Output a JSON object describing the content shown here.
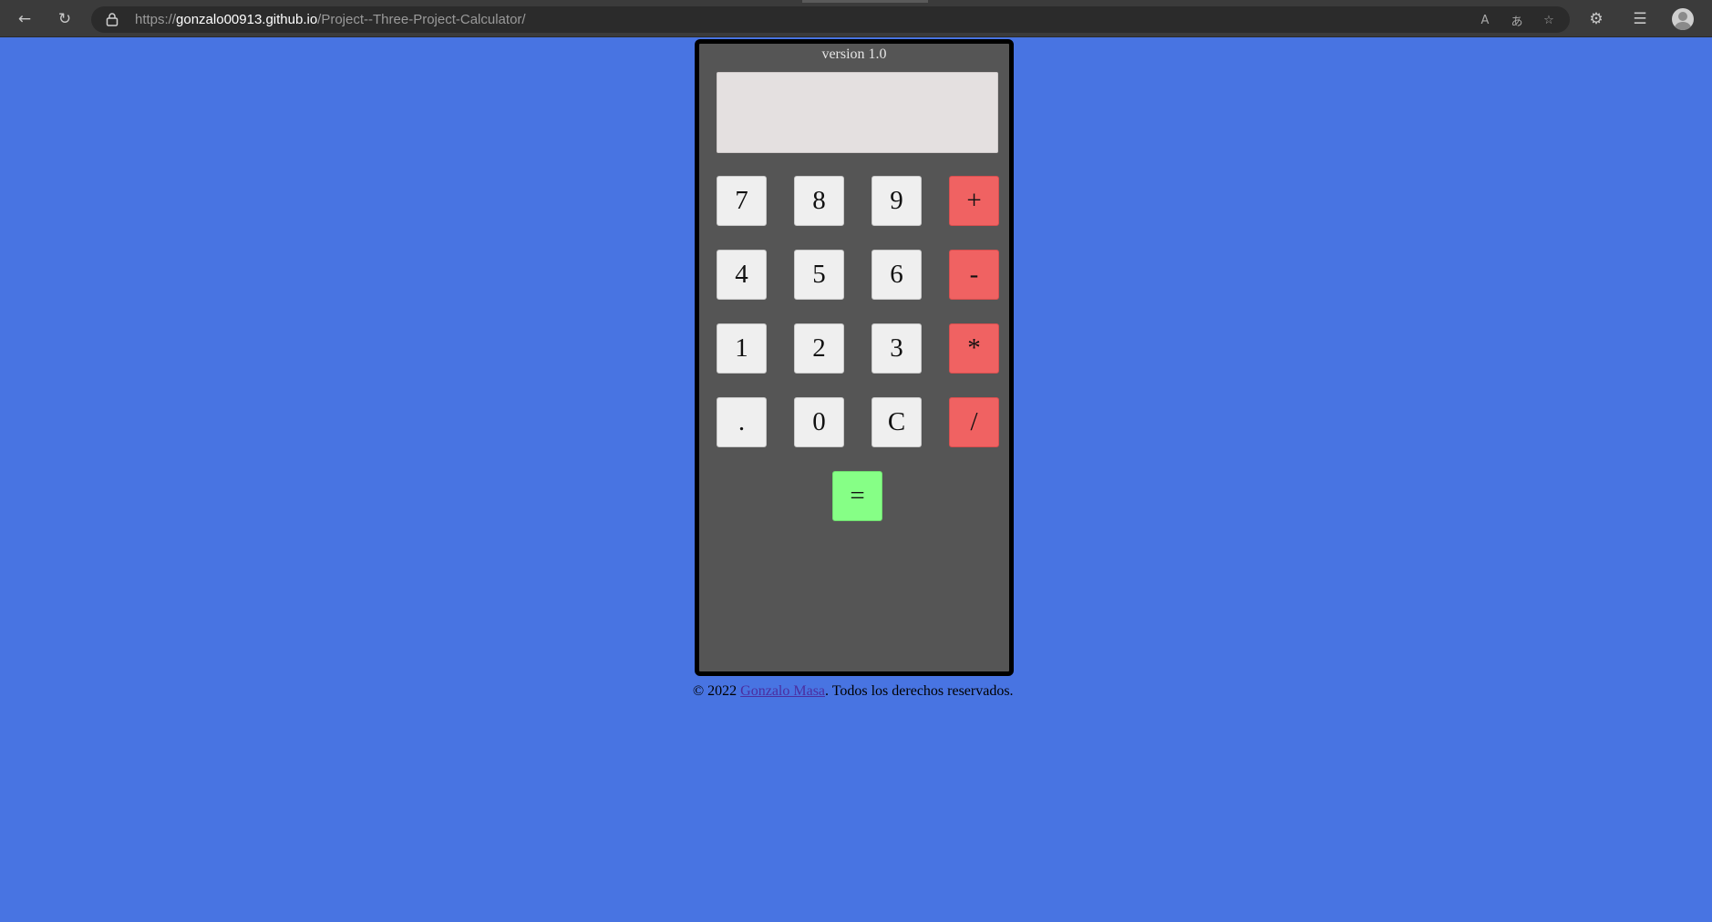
{
  "browser": {
    "url_protocol": "https://",
    "url_host": "gonzalo00913.github.io",
    "url_path": "/Project--Three-Project-Calculator/",
    "icons": [
      "back-icon",
      "refresh-icon",
      "lock-icon",
      "read-aloud-icon",
      "translate-icon",
      "add-favorite-icon",
      "extensions-icon",
      "favorites-icon",
      "profile-icon"
    ]
  },
  "calculator": {
    "version": "version 1.0",
    "display_value": "",
    "keys": {
      "seven": "7",
      "eight": "8",
      "nine": "9",
      "plus": "+",
      "four": "4",
      "five": "5",
      "six": "6",
      "minus": "-",
      "one": "1",
      "two": "2",
      "three": "3",
      "multiply": "*",
      "dot": ".",
      "zero": "0",
      "clear": "C",
      "divide": "/",
      "equals": "="
    },
    "colors": {
      "body": "#555555",
      "operator": "#f06262",
      "equals": "#86ff86",
      "display": "#e4e0e0"
    }
  },
  "footer": {
    "prefix": "© 2022 ",
    "author_link": "Gonzalo Masa",
    "suffix": ". Todos los derechos reservados."
  },
  "page": {
    "background": "#4874e2"
  }
}
